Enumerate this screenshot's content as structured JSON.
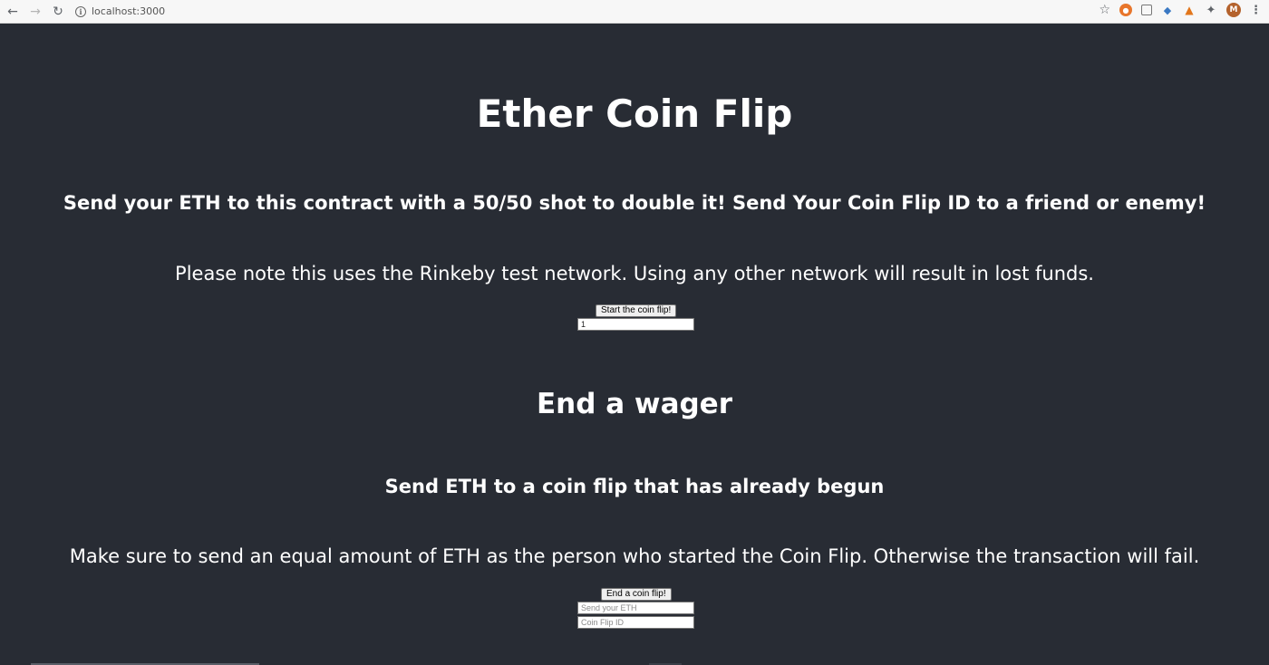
{
  "browser": {
    "url": "localhost:3000",
    "back_icon": "arrow-left-icon",
    "forward_icon": "arrow-right-icon",
    "reload_icon": "reload-icon",
    "avatar_letter": "M"
  },
  "page": {
    "title": "Ether Coin Flip",
    "subtitle": "Send your ETH to this contract with a 50/50 shot to double it! Send Your Coin Flip ID to a friend or enemy!",
    "note": "Please note this uses the Rinkeby test network. Using any other network will result in lost funds.",
    "start_button": "Start the coin flip!",
    "start_input_value": "1",
    "end_heading": "End a wager",
    "end_subheading": "Send ETH to a coin flip that has already begun",
    "end_note": "Make sure to send an equal amount of ETH as the person who started the Coin Flip. Otherwise the transaction will fail.",
    "end_button": "End a coin flip!",
    "eth_placeholder": "Send your ETH",
    "id_placeholder": "Coin Flip ID"
  },
  "colors": {
    "background": "#282c34",
    "text": "#ffffff"
  }
}
